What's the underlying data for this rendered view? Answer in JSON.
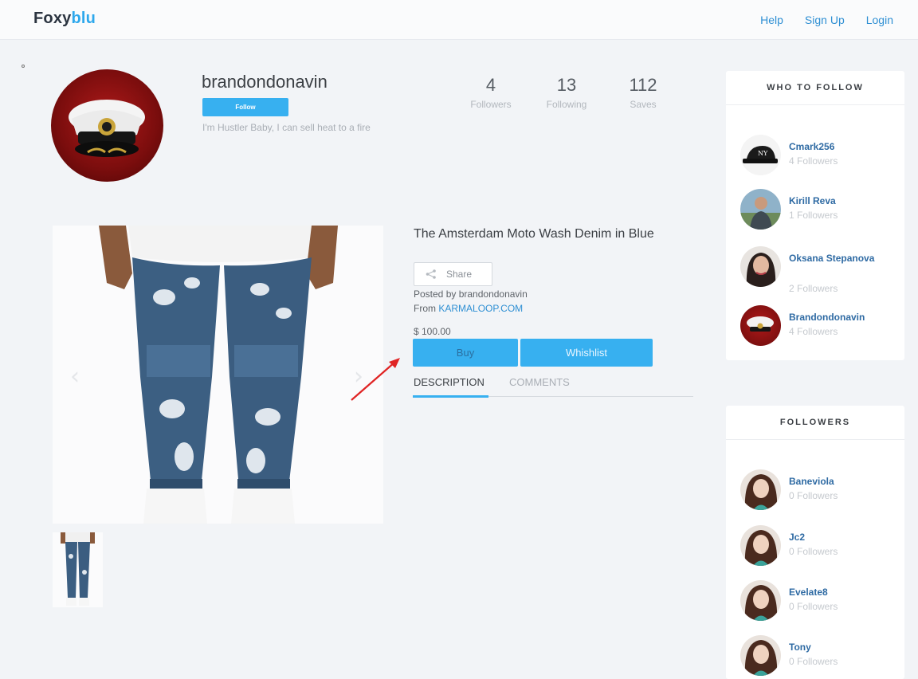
{
  "header": {
    "logo_part1": "Foxy",
    "logo_part2": "blu",
    "nav": [
      "Help",
      "Sign Up",
      "Login"
    ]
  },
  "profile": {
    "username": "brandondonavin",
    "follow_label": "Follow",
    "bio": "I'm Hustler Baby, I can sell heat to a fire",
    "stats": [
      {
        "value": "4",
        "label": "Followers"
      },
      {
        "value": "13",
        "label": "Following"
      },
      {
        "value": "112",
        "label": "Saves"
      }
    ]
  },
  "product": {
    "title": "The Amsterdam Moto Wash Denim in Blue",
    "share_label": "Share",
    "posted_by": "Posted by brandondonavin",
    "from_prefix": "From ",
    "from_link": "KARMALOOP.COM",
    "price": "$ 100.00",
    "buy_label": "Buy",
    "wishlist_label": "Whishlist",
    "tabs": [
      "DESCRIPTION",
      "COMMENTS"
    ],
    "prev_arrow": "‹",
    "next_arrow": "›"
  },
  "who_to_follow": {
    "title": "WHO TO FOLLOW",
    "people": [
      {
        "name": "Cmark256",
        "followers": "4 Followers"
      },
      {
        "name": "Kirill Reva",
        "followers": "1 Followers"
      },
      {
        "name": "Oksana Stepanova",
        "followers": "2 Followers"
      },
      {
        "name": "Brandondonavin",
        "followers": "4 Followers"
      }
    ]
  },
  "followers": {
    "title": "FOLLOWERS",
    "people": [
      {
        "name": "Baneviola",
        "followers": "0 Followers"
      },
      {
        "name": "Jc2",
        "followers": "0 Followers"
      },
      {
        "name": "Evelate8",
        "followers": "0 Followers"
      },
      {
        "name": "Tony",
        "followers": "0 Followers"
      }
    ]
  },
  "colors": {
    "accent": "#37b0f0",
    "link": "#2e8fd3",
    "name_link": "#2e6aa3"
  }
}
